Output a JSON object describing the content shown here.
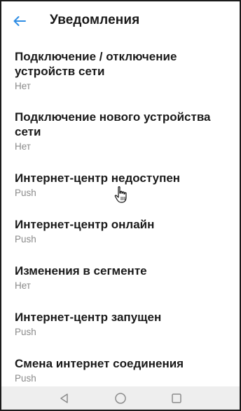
{
  "header": {
    "title": "Уведомления",
    "back_icon": "arrow-left-icon"
  },
  "colors": {
    "accent": "#2f8de4",
    "text_primary": "#1a1a1a",
    "text_secondary": "#8a8a8a",
    "navbar_bg": "#eeeeee"
  },
  "items": [
    {
      "title": "Подключение / отключение устройств сети",
      "value": "Нет"
    },
    {
      "title": "Подключение нового устройства сети",
      "value": "Нет"
    },
    {
      "title": "Интернет-центр недоступен",
      "value": "Push"
    },
    {
      "title": "Интернет-центр онлайн",
      "value": "Push"
    },
    {
      "title": "Изменения в сегменте",
      "value": "Нет"
    },
    {
      "title": "Интернет-центр запущен",
      "value": "Push"
    },
    {
      "title": "Смена интернет соединения",
      "value": "Push"
    }
  ],
  "navbar": {
    "back_icon": "triangle-back-icon",
    "home_icon": "circle-home-icon",
    "recents_icon": "square-recents-icon"
  }
}
